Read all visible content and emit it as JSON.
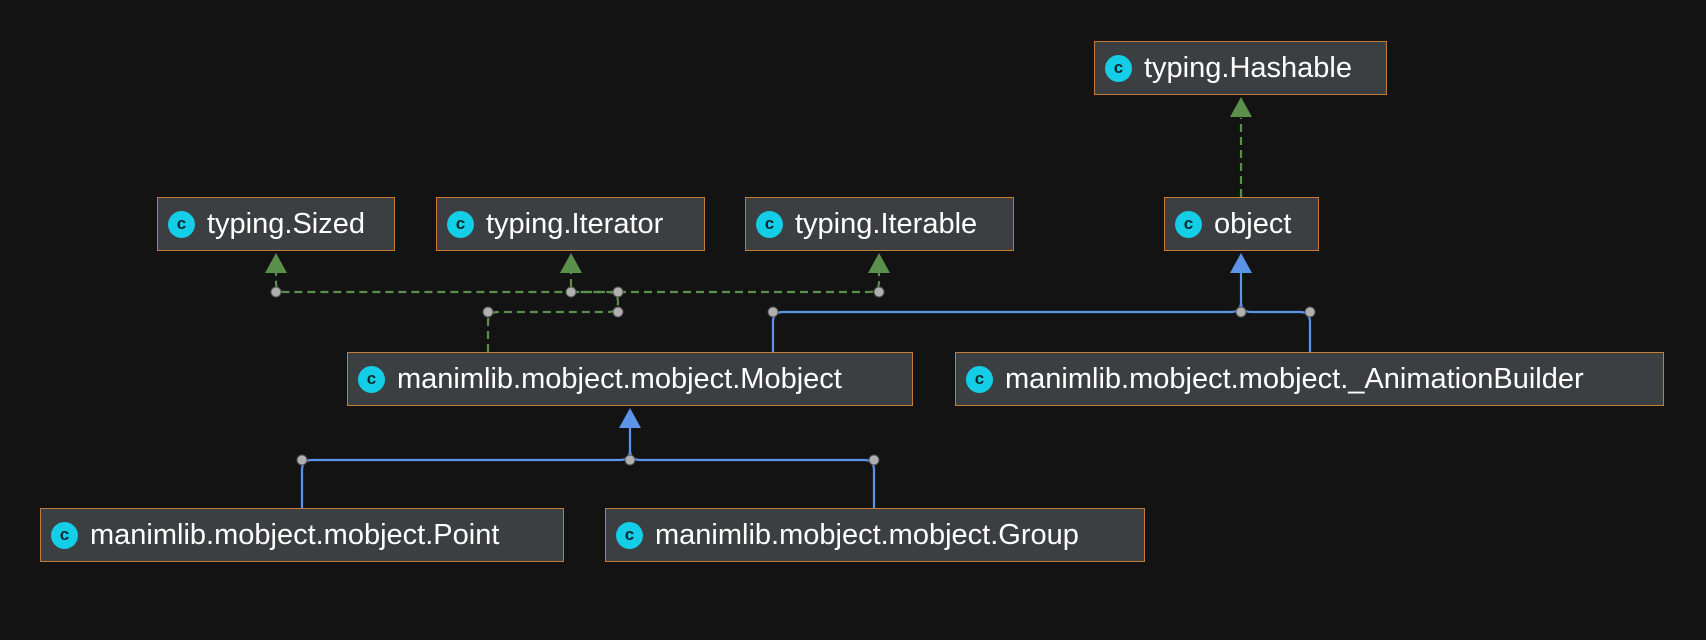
{
  "diagram": {
    "background": "#131313",
    "node_fill": "#3c3f41",
    "node_border": "#c57c35",
    "class_icon_color": "#14cde6",
    "class_icon_letter": "c",
    "colors": {
      "extends_edge": "#5b94e9",
      "implements_edge": "#5b8f4c",
      "connector_dot": "#b0b0b0"
    },
    "nodes": [
      {
        "id": "hashable",
        "label": "typing.Hashable"
      },
      {
        "id": "sized",
        "label": "typing.Sized"
      },
      {
        "id": "iterator",
        "label": "typing.Iterator"
      },
      {
        "id": "iterable",
        "label": "typing.Iterable"
      },
      {
        "id": "object",
        "label": "object"
      },
      {
        "id": "mobject",
        "label": "manimlib.mobject.mobject.Mobject"
      },
      {
        "id": "animbuilder",
        "label": "manimlib.mobject.mobject._AnimationBuilder"
      },
      {
        "id": "point",
        "label": "manimlib.mobject.mobject.Point"
      },
      {
        "id": "group",
        "label": "manimlib.mobject.mobject.Group"
      }
    ],
    "edges": [
      {
        "from": "object",
        "to": "hashable",
        "kind": "implements"
      },
      {
        "from": "mobject",
        "to": "sized",
        "kind": "implements"
      },
      {
        "from": "mobject",
        "to": "iterator",
        "kind": "implements"
      },
      {
        "from": "mobject",
        "to": "iterable",
        "kind": "implements"
      },
      {
        "from": "mobject",
        "to": "object",
        "kind": "extends"
      },
      {
        "from": "animbuilder",
        "to": "object",
        "kind": "extends"
      },
      {
        "from": "point",
        "to": "mobject",
        "kind": "extends"
      },
      {
        "from": "group",
        "to": "mobject",
        "kind": "extends"
      }
    ]
  }
}
